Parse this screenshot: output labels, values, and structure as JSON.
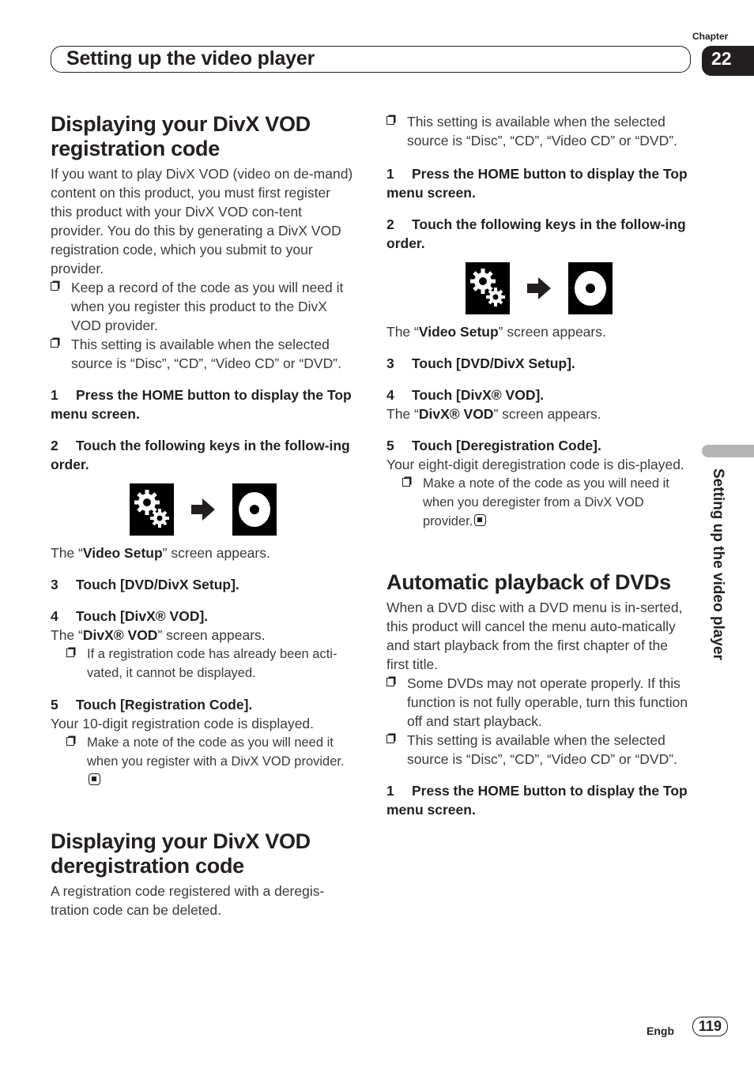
{
  "header": {
    "title": "Setting up the video player",
    "chapter_label": "Chapter",
    "chapter_number": "22"
  },
  "side_tab": {
    "label": "Setting up the video player"
  },
  "left": {
    "section1": {
      "title": "Displaying your DivX VOD registration code",
      "intro": "If you want to play DivX VOD (video on de-mand) content on this product, you must first register this product with your DivX VOD con-tent provider. You do this by generating a DivX VOD registration code, which you submit to your provider.",
      "notes": [
        "Keep a record of the code as you will need it when you register this product to the DivX VOD provider.",
        "This setting is available when the selected source is “Disc”, “CD”, “Video CD” or “DVD”."
      ],
      "step1": {
        "num": "1",
        "text": "Press the HOME button to display the Top menu screen."
      },
      "step2": {
        "num": "2",
        "text": "Touch the following keys in the follow-ing order."
      },
      "keys": [
        "settings-key",
        "disc-key"
      ],
      "video_setup_pre": "The “",
      "video_setup_bold": "Video Setup",
      "video_setup_post": "” screen appears.",
      "step3": {
        "num": "3",
        "text": "Touch [DVD/DivX Setup]."
      },
      "step4": {
        "num": "4",
        "text": "Touch [DivX® VOD]."
      },
      "divx_pre": "The “",
      "divx_bold": "DivX® VOD",
      "divx_post": "” screen appears.",
      "note_activated": "If a registration code has already been acti-vated, it cannot be displayed.",
      "step5": {
        "num": "5",
        "text": "Touch [Registration Code]."
      },
      "result": "Your 10-digit registration code is displayed.",
      "note_final": "Make a note of the code as you will need it when you register with a DivX VOD provider."
    },
    "section2": {
      "title": "Displaying your DivX VOD deregistration code",
      "intro": "A registration code registered with a deregis-tration code can be deleted."
    }
  },
  "right": {
    "note_source": "This setting is available when the selected source is “Disc”, “CD”, “Video CD” or “DVD”.",
    "step1": {
      "num": "1",
      "text": "Press the HOME button to display the Top menu screen."
    },
    "step2": {
      "num": "2",
      "text": "Touch the following keys in the follow-ing order."
    },
    "video_setup_pre": "The “",
    "video_setup_bold": "Video Setup",
    "video_setup_post": "” screen appears.",
    "step3": {
      "num": "3",
      "text": "Touch [DVD/DivX Setup]."
    },
    "step4": {
      "num": "4",
      "text": "Touch [DivX® VOD]."
    },
    "divx_pre": "The “",
    "divx_bold": "DivX® VOD",
    "divx_post": "” screen appears.",
    "step5": {
      "num": "5",
      "text": "Touch [Deregistration Code]."
    },
    "result": "Your eight-digit deregistration code is dis-played.",
    "note_final": "Make a note of the code as you will need it when you deregister from a DivX VOD provider.",
    "section3": {
      "title": "Automatic playback of DVDs",
      "intro": "When a DVD disc with a DVD menu is in-serted, this product will cancel the menu auto-matically and start playback from the first chapter of the first title.",
      "notes": [
        "Some DVDs may not operate properly. If this function is not fully operable, turn this function off and start playback.",
        "This setting is available when the selected source is “Disc”, “CD”, “Video CD” or “DVD”."
      ],
      "step1": {
        "num": "1",
        "text": "Press the HOME button to display the Top menu screen."
      }
    }
  },
  "footer": {
    "language": "Engb",
    "page": "119"
  }
}
